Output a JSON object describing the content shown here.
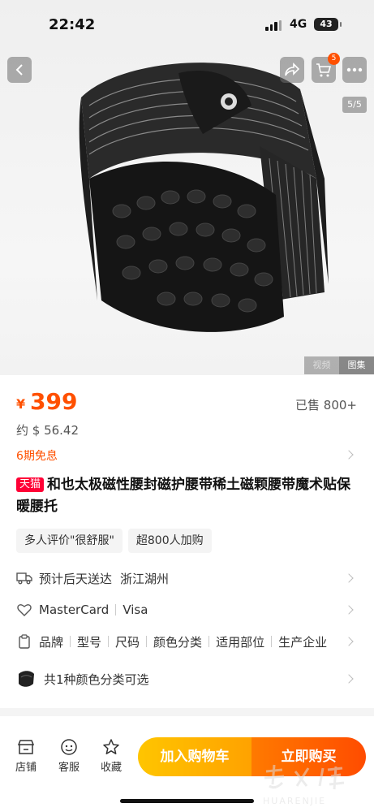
{
  "status_bar": {
    "time": "22:42",
    "network": "4G",
    "battery": "43"
  },
  "gallery": {
    "cart_badge": "5",
    "page_counter": "5/5",
    "media_tabs": [
      "视频",
      "图集"
    ],
    "active_tab": "图集"
  },
  "price": {
    "currency": "¥",
    "value": "399",
    "sold": "已售 800+",
    "usd": "约 $ 56.42",
    "installment": "6期免息"
  },
  "title": {
    "badge": "天猫",
    "text": "和也太极磁性腰封磁护腰带稀土磁颗腰带魔术贴保暖腰托"
  },
  "tags": [
    "多人评价\"很舒服\"",
    "超800人加购"
  ],
  "delivery": {
    "label": "预计后天送达",
    "location": "浙江湖州"
  },
  "payment": [
    "MasterCard",
    "Visa"
  ],
  "specs": [
    "品牌",
    "型号",
    "尺码",
    "颜色分类",
    "适用部位",
    "生产企业"
  ],
  "variants": {
    "label": "共1种颜色分类可选"
  },
  "bottom_bar": {
    "store": "店铺",
    "service": "客服",
    "favorite": "收藏",
    "add_to_cart": "加入购物车",
    "buy_now": "立即购买"
  },
  "colors": {
    "accent": "#ff5000",
    "tmall": "#ff0036",
    "cart_start": "#ffc500",
    "buy_end": "#ff4c00"
  },
  "watermark": "华人街"
}
